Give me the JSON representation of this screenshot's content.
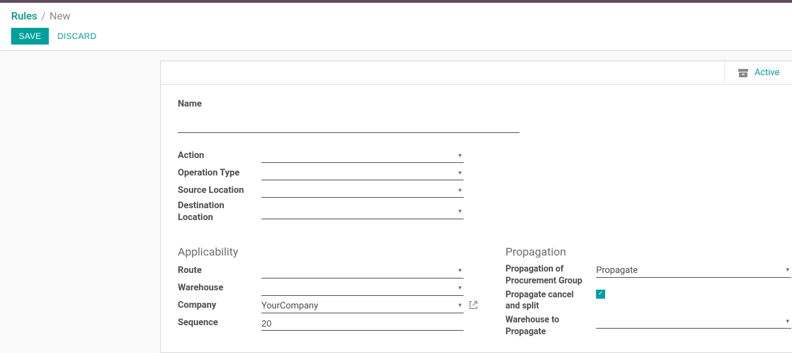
{
  "breadcrumb": {
    "root": "Rules",
    "sep": "/",
    "current": "New"
  },
  "buttons": {
    "save": "SAVE",
    "discard": "DISCARD"
  },
  "status": {
    "active": "Active"
  },
  "labels": {
    "name": "Name",
    "action": "Action",
    "operation_type": "Operation Type",
    "source_location": "Source Location",
    "destination_location": "Destination Location",
    "applicability": "Applicability",
    "route": "Route",
    "warehouse": "Warehouse",
    "company": "Company",
    "sequence": "Sequence",
    "propagation": "Propagation",
    "propagation_of_procurement_group": "Propagation of Procurement Group",
    "propagate_cancel_and_split": "Propagate cancel and split",
    "warehouse_to_propagate": "Warehouse to Propagate"
  },
  "values": {
    "name": "",
    "action": "",
    "operation_type": "",
    "source_location": "",
    "destination_location": "",
    "route": "",
    "warehouse": "",
    "company": "YourCompany",
    "sequence": "20",
    "propagation_of_procurement_group": "Propagate",
    "propagate_cancel_and_split": true,
    "warehouse_to_propagate": ""
  }
}
